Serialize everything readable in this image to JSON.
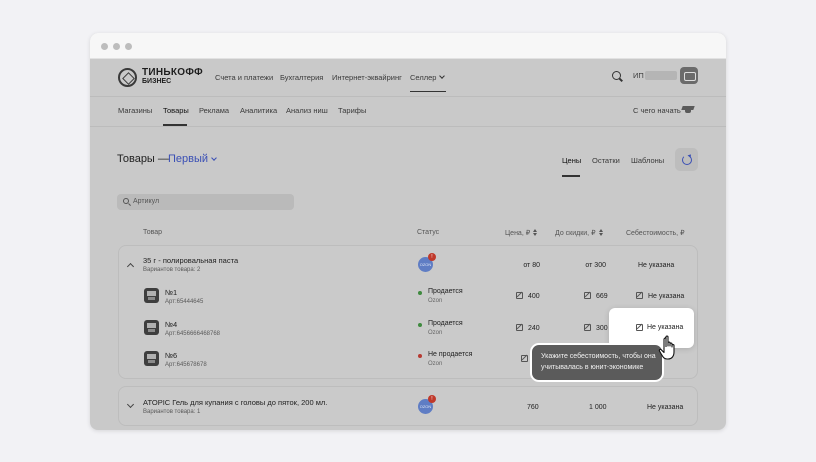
{
  "brand": {
    "name": "ТИНЬКОФФ",
    "sub": "БИЗНЕС"
  },
  "topnav": {
    "items": [
      "Счета и платежи",
      "Бухгалтерия",
      "Интернет-эквайринг"
    ],
    "active": "Селлер",
    "account_label": "ИП"
  },
  "subnav": {
    "items": [
      "Магазины",
      "Товары",
      "Реклама",
      "Аналитика",
      "Анализ ниш",
      "Тарифы"
    ],
    "help": "С чего начать"
  },
  "page": {
    "title": "Товары —",
    "store": "Первый",
    "tabs": [
      "Цены",
      "Остатки",
      "Шаблоны"
    ],
    "search_placeholder": "Артикул"
  },
  "table": {
    "headers": {
      "product": "Товар",
      "status": "Статус",
      "price": "Цена, ₽",
      "before_discount": "До скидки, ₽",
      "cost": "Себестоимость, ₽"
    }
  },
  "groups": [
    {
      "name": "35 г - полировальная паста",
      "variants": "Вариантов товара: 2",
      "marketplace": "OZON",
      "badge": "!",
      "price": "от 80",
      "before": "от 300",
      "cost": "Не указана",
      "items": [
        {
          "name": "№1",
          "article": "Арт:65444645",
          "status": "Продается",
          "mp": "Ozon",
          "status_color": "#3f8a3f",
          "price": "400",
          "before": "669",
          "cost": "Не указана"
        },
        {
          "name": "№4",
          "article": "Арт:6456666468768",
          "status": "Продается",
          "mp": "Ozon",
          "status_color": "#3f8a3f",
          "price": "240",
          "before": "300",
          "cost": "Не указана"
        },
        {
          "name": "№6",
          "article": "Арт:645678678",
          "status": "Не продается",
          "mp": "Ozon",
          "status_color": "#b63a32"
        }
      ]
    },
    {
      "name": "ATOPIC Гель для купания с головы до пяток, 200 мл.",
      "variants": "Вариантов товара: 1",
      "marketplace": "OZON",
      "badge": "!",
      "price": "760",
      "before": "1 000",
      "cost": "Не указана"
    }
  ],
  "tooltip": {
    "line1": "Укажите себестоимость, чтобы она",
    "line2": "учитывалась в юнит-экономике"
  }
}
